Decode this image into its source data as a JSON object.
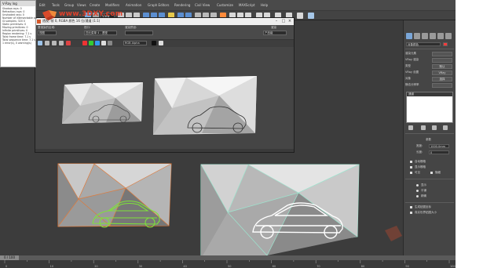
{
  "log": {
    "title": "V-Ray log",
    "lines": [
      "Shadow-rays: 0",
      "Refraction-rays: 0",
      "Unshaded rays: 0",
      "Number of intersectable pri",
      "GI samples: 320 0",
      "Static primitives: 0",
      "Moving primitives: 0",
      "Infinite primitives: 0",
      "Region rendering: 7.1 s",
      "Total frame time: 7.1 s",
      "Total sequence time: 7.1 s",
      "1 error(s), 0 warning(s)"
    ]
  },
  "watermark": {
    "text": "www.3DXY.com"
  },
  "toolbar": {
    "menu": [
      "Edit",
      "Tools",
      "Group",
      "Views",
      "Create",
      "Modifiers",
      "Animation",
      "Graph Editors",
      "Rendering",
      "Civil View",
      "Customize",
      "MAXScript",
      "Help"
    ],
    "view_dropdown": "View"
  },
  "render_window": {
    "title": "透视, 帧 0, RGBA 颜色 16 位/通道 (1:1)",
    "area_to_render_label": "要渲染的区域:",
    "area_value": "视图",
    "viewport_label": "视口:",
    "viewport_value": "四元菜单 4 - 透视",
    "preset_label": "渲染预设:",
    "preset_value": "",
    "render_button": "渲染",
    "production_value": "产品级",
    "channel_value": "RGB Alpha"
  },
  "panel": {
    "object_color_label": "对象颜色",
    "fields": [
      {
        "label": "渲染元素",
        "value": ""
      },
      {
        "label": "VRay 渲染",
        "value": ""
      },
      {
        "label": "类型",
        "value": "默认"
      },
      {
        "label": "VRay 设置",
        "value": "VRay"
      },
      {
        "label": "对象",
        "value": "选择"
      },
      {
        "label": "静态分辨率",
        "value": ""
      }
    ],
    "list_header": "通道",
    "group_params": "参数",
    "spinners": [
      {
        "label": "宽度:",
        "value": "1000.0mm"
      },
      {
        "label": "长度:",
        "value": "0"
      }
    ],
    "checks": [
      "自动栅格",
      "显示栅格",
      "可见",
      "隐藏"
    ],
    "options": [
      "显示",
      "平铺",
      "精确"
    ],
    "bottom_checks": [
      "生成贴图坐标",
      "真实世界贴图大小"
    ]
  },
  "timeline": {
    "frame_label": "0 / 100",
    "ticks": [
      0,
      5,
      10,
      15,
      20,
      25,
      30,
      35,
      40,
      45,
      50,
      55,
      60,
      65,
      70,
      75,
      80,
      85,
      90,
      95,
      100
    ]
  }
}
